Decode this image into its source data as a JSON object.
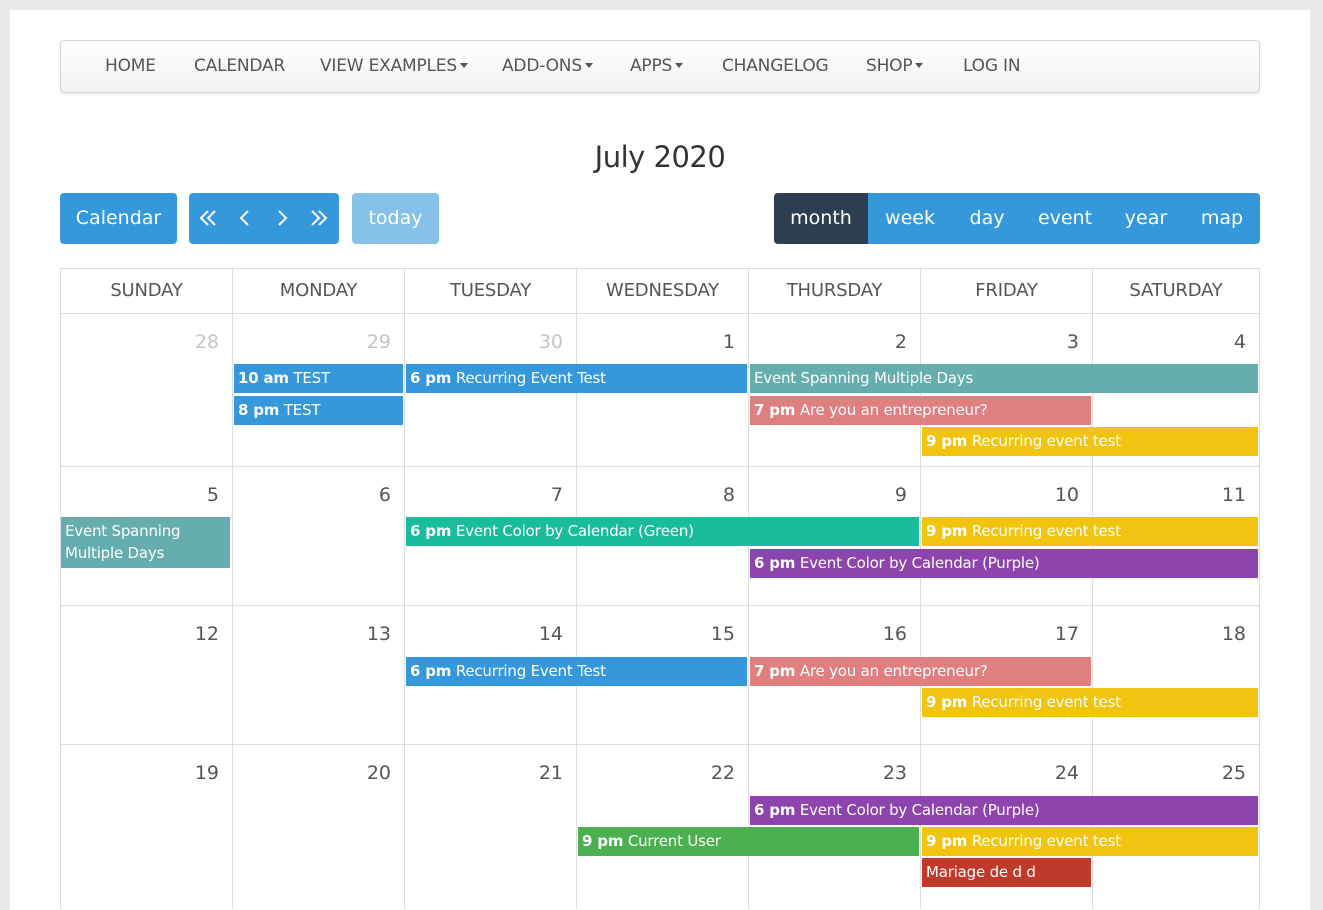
{
  "nav": {
    "home": "HOME",
    "calendar": "CALENDAR",
    "view_examples": "VIEW EXAMPLES",
    "addons": "ADD-ONS",
    "apps": "APPS",
    "changelog": "CHANGELOG",
    "shop": "SHOP",
    "login": "LOG IN"
  },
  "title": "July 2020",
  "toolbar": {
    "calendar_label": "Calendar",
    "today_label": "today",
    "views": [
      "month",
      "week",
      "day",
      "event",
      "year",
      "map"
    ],
    "active_view": "month"
  },
  "weekdays": [
    "SUNDAY",
    "MONDAY",
    "TUESDAY",
    "WEDNESDAY",
    "THURSDAY",
    "FRIDAY",
    "SATURDAY"
  ],
  "weeks": [
    [
      "28",
      "29",
      "30",
      "1",
      "2",
      "3",
      "4"
    ],
    [
      "5",
      "6",
      "7",
      "8",
      "9",
      "10",
      "11"
    ],
    [
      "12",
      "13",
      "14",
      "15",
      "16",
      "17",
      "18"
    ],
    [
      "19",
      "20",
      "21",
      "22",
      "23",
      "24",
      "25"
    ]
  ],
  "events": [
    {
      "time": "10 am",
      "title": "TEST",
      "color": "#3498db"
    },
    {
      "time": "8 pm",
      "title": "TEST",
      "color": "#3498db"
    },
    {
      "time": "6 pm",
      "title": "Recurring Event Test",
      "color": "#3498db"
    },
    {
      "time": "",
      "title": "Event Spanning Multiple Days",
      "color": "#65aead"
    },
    {
      "time": "7 pm",
      "title": "Are you an entrepreneur?",
      "color": "#df7f7f"
    },
    {
      "time": "9 pm",
      "title": "Recurring event test",
      "color": "#f1c40f"
    },
    {
      "time": "",
      "title": "Event Spanning Multiple Days",
      "color": "#65aead"
    },
    {
      "time": "6 pm",
      "title": "Event Color by Calendar (Green)",
      "color": "#1abc9c"
    },
    {
      "time": "9 pm",
      "title": "Recurring event test",
      "color": "#f1c40f"
    },
    {
      "time": "6 pm",
      "title": "Event Color by Calendar (Purple)",
      "color": "#8e44ad"
    },
    {
      "time": "6 pm",
      "title": "Recurring Event Test",
      "color": "#3498db"
    },
    {
      "time": "7 pm",
      "title": "Are you an entrepreneur?",
      "color": "#df7f7f"
    },
    {
      "time": "9 pm",
      "title": "Recurring event test",
      "color": "#f1c40f"
    },
    {
      "time": "6 pm",
      "title": "Event Color by Calendar (Purple)",
      "color": "#8e44ad"
    },
    {
      "time": "9 pm",
      "title": "Current User",
      "color": "#4caf50"
    },
    {
      "time": "9 pm",
      "title": "Recurring event test",
      "color": "#f1c40f"
    },
    {
      "time": "",
      "title": "Mariage de d d",
      "color": "#c0392b"
    }
  ]
}
